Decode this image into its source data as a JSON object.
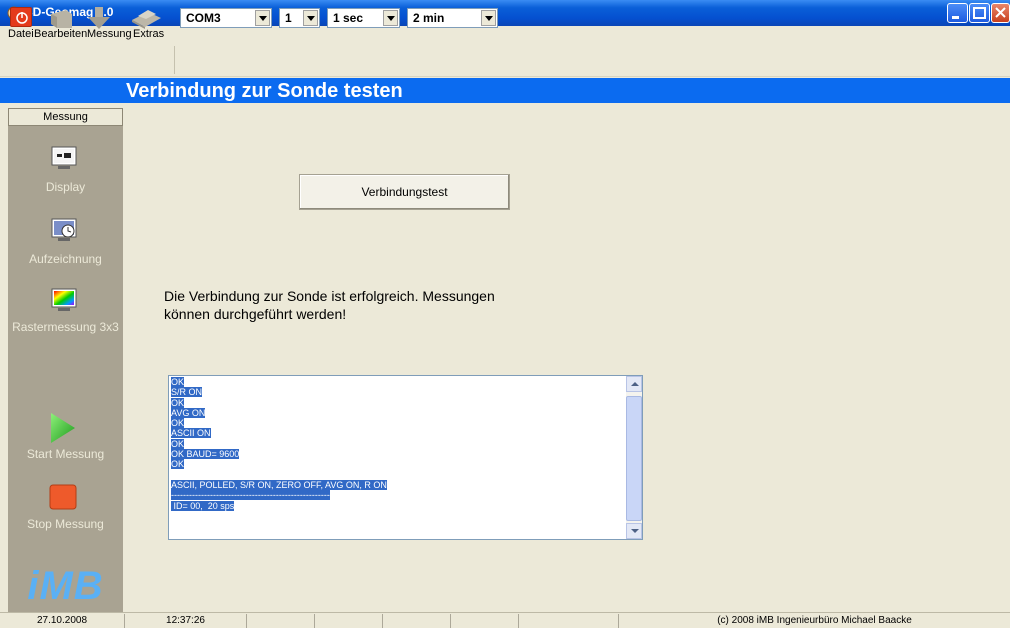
{
  "window": {
    "title": "3D-Geomag 1.0"
  },
  "menu": [
    "Datei",
    "Bearbeiten",
    "Messung",
    "Extras"
  ],
  "toolbar": {
    "port": "COM3",
    "channel": "1",
    "interval": "1 sec",
    "duration": "2 min"
  },
  "header": {
    "title": "Verbindung zur Sonde testen"
  },
  "sidebar": {
    "section": "Messung",
    "items": [
      "Display",
      "Aufzeichnung",
      "Rastermessung 3x3",
      "Start Messung",
      "Stop Messung"
    ],
    "logo": "iMB"
  },
  "main": {
    "test_button": "Verbindungstest",
    "status_line1": "Die Verbindung zur Sonde ist erfolgreich. Messungen",
    "status_line2": "können durchgeführt werden!",
    "console": [
      "OK",
      "S/R ON",
      "OK",
      "AVG ON",
      "OK",
      "ASCII ON",
      "OK",
      "OK BAUD= 9600",
      "OK",
      "",
      "ASCII, POLLED, S/R ON, ZERO OFF, AVG ON, R ON",
      "-----------------------------------------------------",
      " ID= 00,  20 sps"
    ]
  },
  "statusbar": {
    "date": "27.10.2008",
    "time": "12:37:26",
    "copyright": "(c) 2008  iMB  Ingenieurbüro Michael Baacke"
  },
  "colors": {
    "header_blue": "#0b6bf0",
    "sidebar_bg": "#a9a392",
    "selection": "#3169c6"
  }
}
